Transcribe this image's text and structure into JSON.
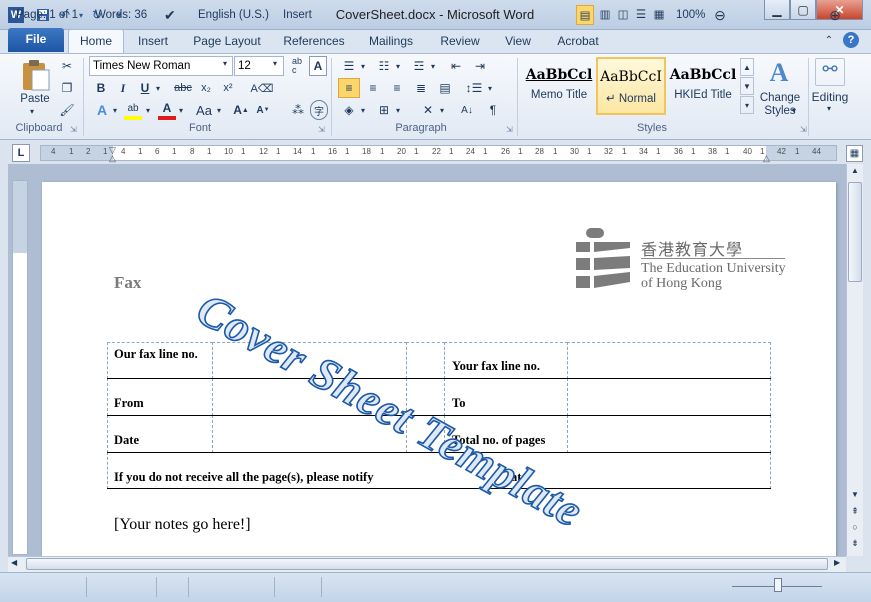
{
  "window": {
    "title": "CoverSheet.docx - Microsoft Word",
    "app_icon": "W"
  },
  "quick_access": {
    "icons": [
      "word-logo-icon",
      "save-icon",
      "undo-icon",
      "redo-icon",
      "customize-icon"
    ]
  },
  "tabs": {
    "file": "File",
    "home": "Home",
    "insert": "Insert",
    "page_layout": "Page Layout",
    "references": "References",
    "mailings": "Mailings",
    "review": "Review",
    "view": "View",
    "acrobat": "Acrobat"
  },
  "clipboard": {
    "paste": "Paste",
    "label": "Clipboard"
  },
  "font": {
    "name": "Times New Roman",
    "size": "12",
    "label": "Font"
  },
  "paragraph": {
    "label": "Paragraph"
  },
  "styles": {
    "items": [
      {
        "preview": "AaBbCcl",
        "name": "Memo Title"
      },
      {
        "preview": "AaBbCcI",
        "name": "↵ Normal"
      },
      {
        "preview": "AaBbCcl",
        "name": "HKIEd Title"
      }
    ],
    "change": "Change Styles",
    "label": "Styles"
  },
  "editing": {
    "label": "Editing"
  },
  "ruler": {
    "h_ticks": [
      "4",
      "1",
      "2",
      "1",
      "4",
      "1",
      "6",
      "1",
      "8",
      "1",
      "10",
      "1",
      "12",
      "1",
      "14",
      "1",
      "16",
      "1",
      "18",
      "1",
      "20",
      "1",
      "22",
      "1",
      "24",
      "1",
      "26",
      "1",
      "28",
      "1",
      "30",
      "1",
      "32",
      "1",
      "34",
      "1",
      "36",
      "1",
      "38",
      "1",
      "40",
      "1",
      "42",
      "1",
      "44"
    ]
  },
  "document": {
    "fax_heading": "Fax",
    "logo": {
      "chinese": "香港教育大學",
      "english_line1": "The Education University",
      "english_line2": "of Hong Kong"
    },
    "table": {
      "our_fax": "Our fax line no.",
      "your_fax": "Your fax line no.",
      "from": "From",
      "to": "To",
      "date": "Date",
      "total": "Total no. of pages",
      "notify": "If you do not receive all the page(s), please notify",
      "at": "at"
    },
    "notes": "[Your notes go here!]",
    "watermark": "Cover Sheet Template"
  },
  "status": {
    "page": "Page: 1 of 1",
    "words": "Words: 36",
    "language": "English (U.S.)",
    "mode": "Insert",
    "zoom": "100%"
  }
}
